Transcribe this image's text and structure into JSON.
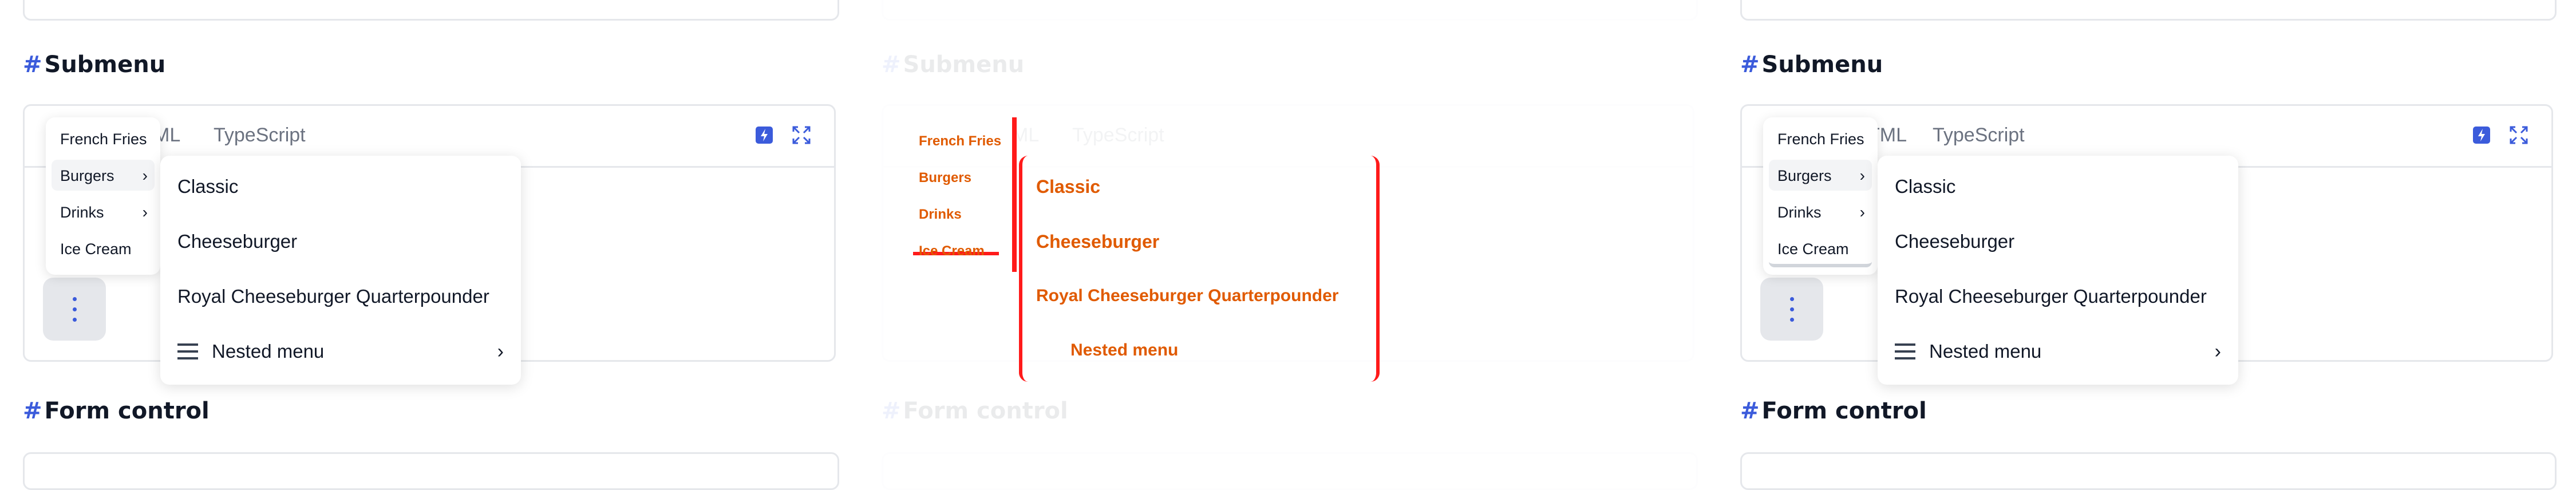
{
  "section_titles": {
    "hash": "#",
    "submenu": "Submenu",
    "form_control": "Form control"
  },
  "tabs": {
    "html_partial": "ML",
    "html_partial_right": "TML",
    "typescript": "TypeScript"
  },
  "toolbar_icons": [
    "bolt-icon",
    "expand-icon"
  ],
  "menu": {
    "items": [
      {
        "label": "French Fries",
        "has_submenu": false
      },
      {
        "label": "Burgers",
        "has_submenu": true,
        "active": true
      },
      {
        "label": "Drinks",
        "has_submenu": true
      },
      {
        "label": "Ice Cream",
        "has_submenu": false
      }
    ],
    "chevron": "›"
  },
  "submenu": {
    "items": [
      {
        "label": "Classic"
      },
      {
        "label": "Cheeseburger"
      },
      {
        "label": "Royal Cheeseburger Quarterpounder"
      }
    ],
    "nested": {
      "label": "Nested menu",
      "chevron": "›"
    }
  },
  "colors": {
    "accent": "#3b5bdb",
    "border": "#e5e7eb",
    "button_bg": "#e5e7eb",
    "highlight_red": "#ff1a1a",
    "highlight_orange": "#e05a00"
  }
}
